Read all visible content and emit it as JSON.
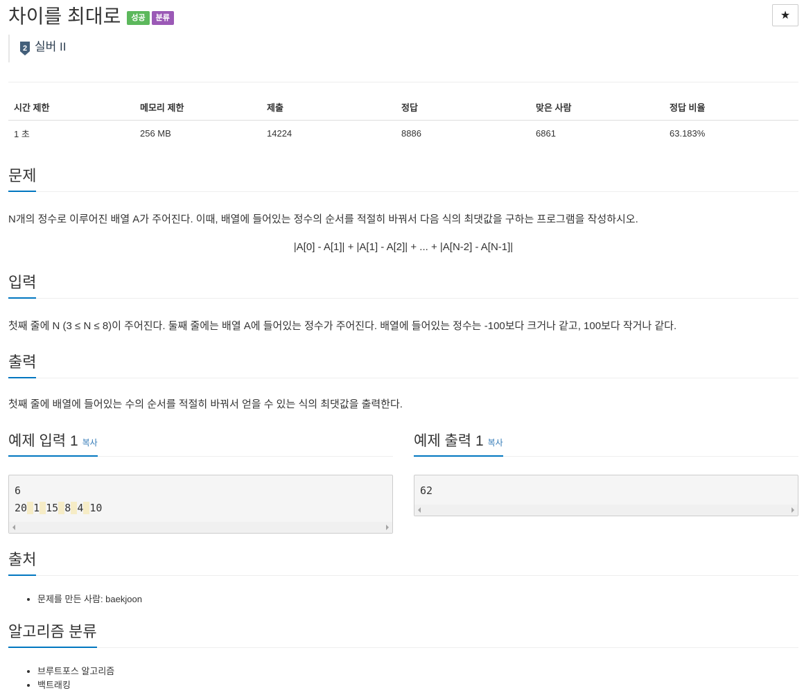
{
  "problem": {
    "title": "차이를 최대로",
    "badges": {
      "success": "성공",
      "classification": "분류"
    },
    "tier": {
      "icon": "silver-tier-icon",
      "number": "2",
      "label": "실버 II"
    },
    "star_glyph": "★"
  },
  "info_table": {
    "headers": [
      "시간 제한",
      "메모리 제한",
      "제출",
      "정답",
      "맞은 사람",
      "정답 비율"
    ],
    "values": [
      "1 초",
      "256 MB",
      "14224",
      "8886",
      "6861",
      "63.183%"
    ]
  },
  "description": {
    "heading": "문제",
    "text": "N개의 정수로 이루어진 배열 A가 주어진다. 이때, 배열에 들어있는 정수의 순서를 적절히 바꿔서 다음 식의 최댓값을 구하는 프로그램을 작성하시오.",
    "formula": "|A[0] - A[1]| + |A[1] - A[2]| + ... + |A[N-2] - A[N-1]|"
  },
  "input": {
    "heading": "입력",
    "text": "첫째 줄에 N (3 ≤ N ≤ 8)이 주어진다. 둘째 줄에는 배열 A에 들어있는 정수가 주어진다. 배열에 들어있는 정수는 -100보다 크거나 같고, 100보다 작거나 같다."
  },
  "output": {
    "heading": "출력",
    "text": "첫째 줄에 배열에 들어있는 수의 순서를 적절히 바꿔서 얻을 수 있는 식의 최댓값을 출력한다."
  },
  "samples": {
    "copy_label": "복사",
    "input_heading": "예제 입력 1",
    "output_heading": "예제 출력 1",
    "input_line1": "6",
    "input_tokens": [
      "20",
      "1",
      "15",
      "8",
      "4",
      "10"
    ],
    "output_line1": "62"
  },
  "source": {
    "heading": "출처",
    "items": [
      "문제를 만든 사람: baekjoon"
    ]
  },
  "algorithms": {
    "heading": "알고리즘 분류",
    "items": [
      "브루트포스 알고리즘",
      "백트래킹"
    ]
  },
  "colors": {
    "accent": "#0076c0",
    "badge_success": "#5cb85c",
    "badge_classification": "#9b59b6",
    "tier_silver": "#435f7a",
    "link": "#337ab7"
  }
}
